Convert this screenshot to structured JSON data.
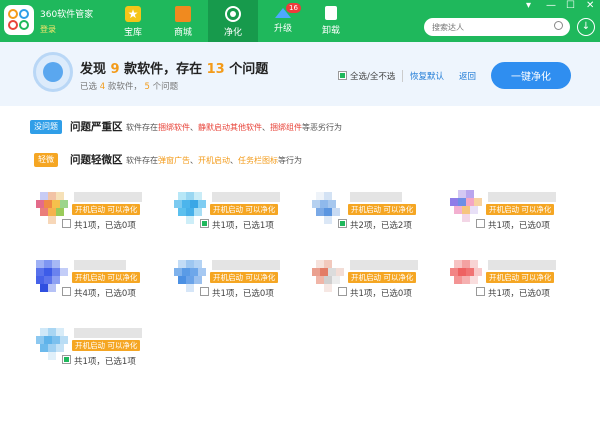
{
  "app": {
    "name": "360软件管家",
    "login": "登录"
  },
  "nav": [
    {
      "label": "宝库",
      "icon": "star-icon"
    },
    {
      "label": "商城",
      "icon": "shop-bag-icon"
    },
    {
      "label": "净化",
      "icon": "clean-icon"
    },
    {
      "label": "升级",
      "icon": "upgrade-arrow-icon",
      "badge": "16"
    },
    {
      "label": "卸载",
      "icon": "trash-icon"
    }
  ],
  "search": {
    "placeholder": "搜索达人"
  },
  "window": {
    "menu": "▾",
    "minimize": "—",
    "maximize": "☐",
    "close": "✕",
    "download": "↓"
  },
  "summary": {
    "t1": "发现 ",
    "found": "9",
    "t2": " 款软件，存在 ",
    "issues": "13",
    "t3": " 个问题",
    "s1": "已选 ",
    "selected_software": "4",
    "s2": " 款软件，  ",
    "selected_issues": "5",
    "s3": " 个问题",
    "select_all": "全选/全不选",
    "restore_default": "恢复默认",
    "back": "返回",
    "clean_button": "一键净化"
  },
  "severe": {
    "tag": "没问题",
    "title": "问题严重区",
    "desc_prefix": "软件存在",
    "h1": "捆绑软件",
    "sep1": "、",
    "h2": "静默启动其他软件",
    "sep2": "、",
    "h3": "捆绑组件",
    "desc_suffix": "等恶劣行为"
  },
  "mild": {
    "tag": "轻微",
    "title": "问题轻微区",
    "desc_prefix": "软件存在",
    "h1": "弹窗广告",
    "sep1": "、",
    "h2": "开机启动",
    "sep2": "、",
    "h3": "任务栏图标",
    "desc_suffix": "等行为"
  },
  "cards": [
    {
      "tag": "开机启动 可以净化",
      "count": "共1项，已选0项",
      "checked": false
    },
    {
      "tag": "开机启动 可以净化",
      "count": "共1项，已选1项",
      "checked": true
    },
    {
      "tag": "开机启动 可以净化",
      "count": "共2项，已选2项",
      "checked": true
    },
    {
      "tag": "开机启动 可以净化",
      "count": "共1项，已选0项",
      "checked": false
    },
    {
      "tag": "开机启动 可以净化",
      "count": "共4项，已选0项",
      "checked": false
    },
    {
      "tag": "开机启动 可以净化",
      "count": "共1项，已选0项",
      "checked": false
    },
    {
      "tag": "开机启动 可以净化",
      "count": "共1项，已选0项",
      "checked": false
    },
    {
      "tag": "开机启动 可以净化",
      "count": "共1项，已选0项",
      "checked": false
    },
    {
      "tag": "开机启动 可以净化",
      "count": "共1项，已选1项",
      "checked": true
    }
  ],
  "colors": {
    "topbar": "#1fb85c",
    "accent_orange": "#f39b1a",
    "tag_blue": "#2f9ee8",
    "tag_orange": "#f5a623",
    "warn_red": "#e8443a",
    "button_blue": "#2f8ef0"
  }
}
